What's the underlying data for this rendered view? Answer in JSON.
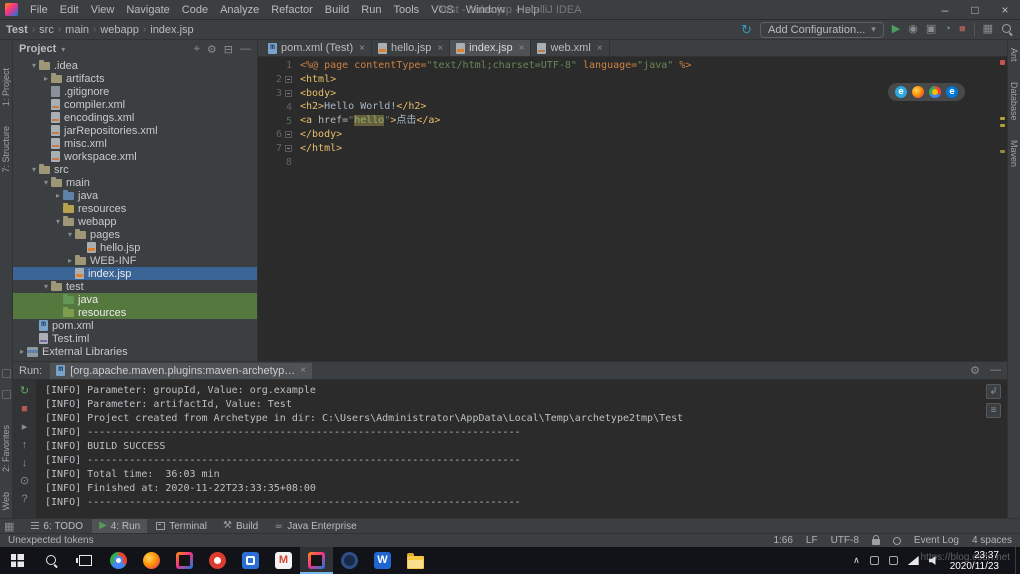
{
  "window": {
    "title": "Test - index.jsp - IntelliJ IDEA"
  },
  "menu": {
    "items": [
      "File",
      "Edit",
      "View",
      "Navigate",
      "Code",
      "Analyze",
      "Refactor",
      "Build",
      "Run",
      "Tools",
      "VCS",
      "Window",
      "Help"
    ]
  },
  "breadcrumb": {
    "items": [
      "Test",
      "src",
      "main",
      "webapp",
      "index.jsp"
    ]
  },
  "toolbar": {
    "config": "Add Configuration..."
  },
  "left_strip": {
    "top": [
      "1: Project",
      "7: Structure"
    ],
    "bottom": [
      "2: Favorites",
      "Web"
    ]
  },
  "right_strip": {
    "labels": [
      "Ant",
      "Database",
      "Maven"
    ]
  },
  "project": {
    "header": "Project",
    "tree": [
      {
        "label": ".idea",
        "indent": 1,
        "arrow": "down",
        "icon": "fold"
      },
      {
        "label": "artifacts",
        "indent": 2,
        "arrow": "right",
        "icon": "fold"
      },
      {
        "label": ".gitignore",
        "indent": 2,
        "icon": "f-git"
      },
      {
        "label": "compiler.xml",
        "indent": 2,
        "icon": "f-xml"
      },
      {
        "label": "encodings.xml",
        "indent": 2,
        "icon": "f-xml"
      },
      {
        "label": "jarRepositories.xml",
        "indent": 2,
        "icon": "f-xml"
      },
      {
        "label": "misc.xml",
        "indent": 2,
        "icon": "f-xml"
      },
      {
        "label": "workspace.xml",
        "indent": 2,
        "icon": "f-xml"
      },
      {
        "label": "src",
        "indent": 1,
        "arrow": "down",
        "icon": "fold"
      },
      {
        "label": "main",
        "indent": 2,
        "arrow": "down",
        "icon": "fold"
      },
      {
        "label": "java",
        "indent": 3,
        "arrow": "right",
        "icon": "fold-src"
      },
      {
        "label": "resources",
        "indent": 3,
        "icon": "fold-res"
      },
      {
        "label": "webapp",
        "indent": 3,
        "arrow": "down",
        "icon": "fold"
      },
      {
        "label": "pages",
        "indent": 4,
        "arrow": "down",
        "icon": "fold"
      },
      {
        "label": "hello.jsp",
        "indent": 5,
        "icon": "f-jsp"
      },
      {
        "label": "WEB-INF",
        "indent": 4,
        "arrow": "right",
        "icon": "fold"
      },
      {
        "label": "index.jsp",
        "indent": 4,
        "icon": "f-jsp",
        "selected": true
      },
      {
        "label": "test",
        "indent": 2,
        "arrow": "down",
        "icon": "fold"
      },
      {
        "label": "java",
        "indent": 3,
        "icon": "fold-test",
        "green": true
      },
      {
        "label": "resources",
        "indent": 3,
        "icon": "fold-testres",
        "green": true
      },
      {
        "label": "pom.xml",
        "indent": 1,
        "icon": "f-maven"
      },
      {
        "label": "Test.iml",
        "indent": 1,
        "icon": "f-iml"
      },
      {
        "label": "External Libraries",
        "indent": 0,
        "arrow": "right",
        "icon": "lib"
      }
    ]
  },
  "editor": {
    "tabs": [
      {
        "label": "pom.xml (Test)",
        "icon": "ic-maven"
      },
      {
        "label": "hello.jsp",
        "icon": "ic-jsp"
      },
      {
        "label": "index.jsp",
        "icon": "ic-jsp",
        "active": true
      },
      {
        "label": "web.xml",
        "icon": "ic-xml"
      }
    ],
    "browser_icons": [
      {
        "id": "ie",
        "glyph": "e"
      },
      {
        "id": "firefox",
        "glyph": ""
      },
      {
        "id": "chrome",
        "glyph": ""
      },
      {
        "id": "edge",
        "glyph": "e"
      }
    ],
    "lines": [
      {
        "num": "1",
        "seg": [
          {
            "t": "<%@ page ",
            "c": "dir"
          },
          {
            "t": "contentType=",
            "c": "dir"
          },
          {
            "t": "\"text/html;charset=UTF-8\"",
            "c": "str"
          },
          {
            "t": " ",
            "c": "dir"
          },
          {
            "t": "language=",
            "c": "dir"
          },
          {
            "t": "\"java\"",
            "c": "str"
          },
          {
            "t": " %>",
            "c": "dir"
          }
        ]
      },
      {
        "num": "2",
        "fold": true,
        "seg": [
          {
            "t": "<html>",
            "c": "tag"
          }
        ]
      },
      {
        "num": "3",
        "fold": true,
        "seg": [
          {
            "t": "<body>",
            "c": "tag"
          }
        ]
      },
      {
        "num": "4",
        "seg": [
          {
            "t": "<h2>",
            "c": "tag"
          },
          {
            "t": "Hello World!",
            "c": "txt"
          },
          {
            "t": "</h2>",
            "c": "tag"
          }
        ]
      },
      {
        "num": "5",
        "seg": [
          {
            "t": "<a ",
            "c": "tag"
          },
          {
            "t": "href=",
            "c": "attr"
          },
          {
            "t": "\"",
            "c": "str"
          },
          {
            "t": "hello",
            "c": "strhl"
          },
          {
            "t": "\"",
            "c": "str"
          },
          {
            "t": ">",
            "c": "tag"
          },
          {
            "t": "点击",
            "c": "txt"
          },
          {
            "t": "</a>",
            "c": "tag"
          }
        ]
      },
      {
        "num": "6",
        "fold": true,
        "seg": [
          {
            "t": "</body>",
            "c": "tag"
          }
        ]
      },
      {
        "num": "7",
        "fold": true,
        "seg": [
          {
            "t": "</html>",
            "c": "tag"
          }
        ]
      },
      {
        "num": "8",
        "seg": []
      }
    ]
  },
  "run": {
    "label": "Run:",
    "tab": "[org.apache.maven.plugins:maven-archetyp…",
    "console": [
      "[INFO] Parameter: groupId, Value: org.example",
      "[INFO] Parameter: artifactId, Value: Test",
      "[INFO] Project created from Archetype in dir: C:\\Users\\Administrator\\AppData\\Local\\Temp\\archetype2tmp\\Test",
      "[INFO] ------------------------------------------------------------------------",
      "[INFO] BUILD SUCCESS",
      "[INFO] ------------------------------------------------------------------------",
      "[INFO] Total time:  36:03 min",
      "[INFO] Finished at: 2020-11-22T23:33:35+08:00",
      "[INFO] ------------------------------------------------------------------------"
    ]
  },
  "tool_bar": {
    "items": [
      {
        "label": "6: TODO",
        "icon": "todo"
      },
      {
        "label": "4: Run",
        "icon": "run",
        "active": true
      },
      {
        "label": "Terminal",
        "icon": "term"
      },
      {
        "label": "Build",
        "icon": "build"
      },
      {
        "label": "Java Enterprise",
        "icon": "coffee"
      }
    ]
  },
  "status_bar": {
    "message": "Unexpected tokens",
    "position": "1:66",
    "line_sep": "LF",
    "encoding": "UTF-8",
    "event_log": "Event Log",
    "indent": "4 spaces"
  },
  "taskbar": {
    "apps": [
      {
        "name": "chrome"
      },
      {
        "name": "firefox"
      },
      {
        "name": "intellij"
      },
      {
        "name": "app-red"
      },
      {
        "name": "app-blue"
      },
      {
        "name": "app-m"
      },
      {
        "name": "intellij-active",
        "active": true
      },
      {
        "name": "app-dark"
      },
      {
        "name": "wps"
      },
      {
        "name": "explorer"
      }
    ],
    "time": "23:37",
    "date": "2020/11/23"
  },
  "watermark": "https://blog.csdn.net"
}
